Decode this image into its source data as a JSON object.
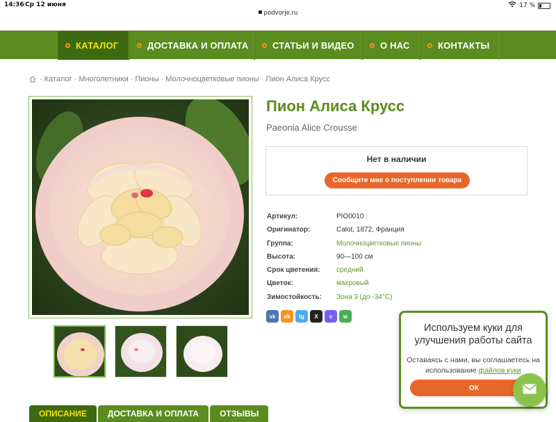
{
  "status_bar": {
    "time": "14:36",
    "date": "Ср 12 июня",
    "url": "podvorje.ru",
    "battery": "17 %"
  },
  "nav": {
    "items": [
      {
        "label": "КАТАЛОГ",
        "active": true
      },
      {
        "label": "ДОСТАВКА И ОПЛАТА",
        "active": false
      },
      {
        "label": "СТАТЬИ И ВИДЕО",
        "active": false
      },
      {
        "label": "О НАС",
        "active": false
      },
      {
        "label": "КОНТАКТЫ",
        "active": false
      }
    ]
  },
  "breadcrumbs": [
    "Каталог",
    "Многолетники",
    "Пионы",
    "Молочноцветковые пионы",
    "Пион Алиса Крусс"
  ],
  "product": {
    "title": "Пион Алиса Крусс",
    "latin_name": "Paeonia Alice Crousse",
    "stock_status": "Нет в наличии",
    "notify_button": "Сообщите мне о поступлении товара",
    "specs": [
      {
        "key": "Артикул:",
        "value": "PIO0010",
        "link": false
      },
      {
        "key": "Оригинатор:",
        "value": "Calot, 1872, Франция",
        "link": false
      },
      {
        "key": "Группа:",
        "value": "Молочноцветковые пионы",
        "link": true
      },
      {
        "key": "Высота:",
        "value": "90—100 см",
        "link": false
      },
      {
        "key": "Срок цветения:",
        "value": "средний",
        "link": true
      },
      {
        "key": "Цветок:",
        "value": "махровый",
        "link": true
      },
      {
        "key": "Зимостойкость:",
        "value": "Зона 3 (до -34°C)",
        "link": true
      }
    ]
  },
  "share": [
    {
      "name": "vk-icon",
      "label": "vk",
      "color": "#4a76a8"
    },
    {
      "name": "odnoklassniki-icon",
      "label": "ok",
      "color": "#f7931e"
    },
    {
      "name": "telegram-icon",
      "label": "tg",
      "color": "#54a9eb"
    },
    {
      "name": "x-icon",
      "label": "X",
      "color": "#222222"
    },
    {
      "name": "viber-icon",
      "label": "v",
      "color": "#7360f2"
    },
    {
      "name": "whatsapp-icon",
      "label": "w",
      "color": "#4caf50"
    }
  ],
  "tabs": [
    {
      "label": "ОПИСАНИЕ",
      "active": true
    },
    {
      "label": "ДОСТАВКА И ОПЛАТА",
      "active": false
    },
    {
      "label": "ОТЗЫВЫ",
      "active": false
    }
  ],
  "cookie": {
    "title": "Используем куки для улучшения работы сайта",
    "text_before": "Оставаясь с нами, вы соглашаетесь на использование",
    "link": "файлов куки",
    "ok": "ОК"
  },
  "colors": {
    "brand_green": "#5b8c1f",
    "active_green": "#3d6a10",
    "accent_orange": "#e8662a",
    "active_yellow": "#f6e100"
  }
}
